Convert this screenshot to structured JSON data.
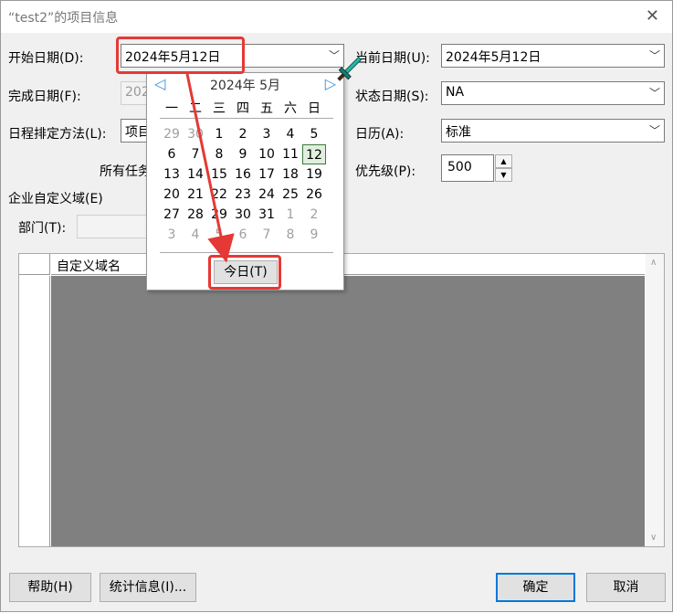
{
  "window": {
    "title": "“test2”的项目信息"
  },
  "fields": {
    "start_date": {
      "label": "开始日期(D):",
      "value": "2024年5月12日"
    },
    "finish_date": {
      "label": "完成日期(F):",
      "value": "202"
    },
    "schedule_from": {
      "label": "日程排定方法(L):",
      "value": "项目"
    },
    "all_tasks": {
      "label": "所有任务"
    },
    "current_date": {
      "label": "当前日期(U):",
      "value": "2024年5月12日"
    },
    "status_date": {
      "label": "状态日期(S):",
      "value": "NA"
    },
    "calendar": {
      "label": "日历(A):",
      "value": "标准"
    },
    "priority": {
      "label": "优先级(P):",
      "value": "500"
    }
  },
  "enterprise": {
    "section_label": "企业自定义域(E)",
    "dept_label": "部门(T):",
    "grid_header": "自定义域名"
  },
  "calendar_popup": {
    "title": "2024年 5月",
    "weekdays": [
      "一",
      "二",
      "三",
      "四",
      "五",
      "六",
      "日"
    ],
    "weeks": [
      [
        {
          "d": "29",
          "o": true
        },
        {
          "d": "30",
          "o": true
        },
        {
          "d": "1"
        },
        {
          "d": "2"
        },
        {
          "d": "3"
        },
        {
          "d": "4"
        },
        {
          "d": "5"
        }
      ],
      [
        {
          "d": "6"
        },
        {
          "d": "7"
        },
        {
          "d": "8"
        },
        {
          "d": "9"
        },
        {
          "d": "10"
        },
        {
          "d": "11"
        },
        {
          "d": "12",
          "t": true
        }
      ],
      [
        {
          "d": "13"
        },
        {
          "d": "14"
        },
        {
          "d": "15"
        },
        {
          "d": "16"
        },
        {
          "d": "17"
        },
        {
          "d": "18"
        },
        {
          "d": "19"
        }
      ],
      [
        {
          "d": "20"
        },
        {
          "d": "21"
        },
        {
          "d": "22"
        },
        {
          "d": "23"
        },
        {
          "d": "24"
        },
        {
          "d": "25"
        },
        {
          "d": "26"
        }
      ],
      [
        {
          "d": "27"
        },
        {
          "d": "28"
        },
        {
          "d": "29"
        },
        {
          "d": "30"
        },
        {
          "d": "31"
        },
        {
          "d": "1",
          "o": true
        },
        {
          "d": "2",
          "o": true
        }
      ],
      [
        {
          "d": "3",
          "o": true
        },
        {
          "d": "4",
          "o": true
        },
        {
          "d": "5",
          "o": true
        },
        {
          "d": "6",
          "o": true
        },
        {
          "d": "7",
          "o": true
        },
        {
          "d": "8",
          "o": true
        },
        {
          "d": "9",
          "o": true
        }
      ]
    ],
    "today_button": "今日(T)"
  },
  "buttons": {
    "help": "帮助(H)",
    "statistics": "统计信息(I)...",
    "ok": "确定",
    "cancel": "取消"
  },
  "colors": {
    "highlight": "#e53935",
    "accent": "#0078d7"
  }
}
